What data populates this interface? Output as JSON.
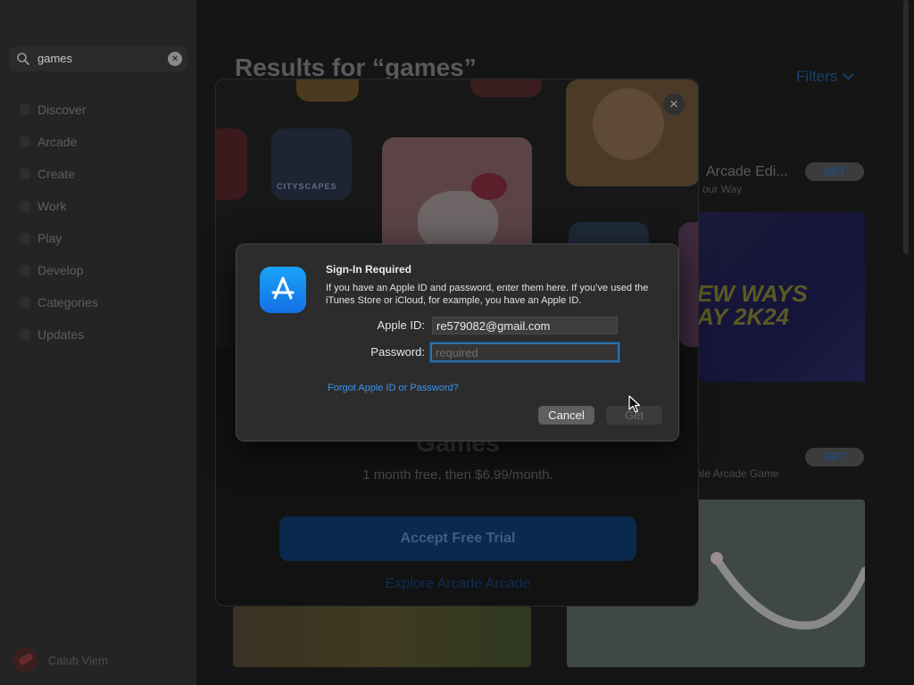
{
  "sidebar": {
    "search_query": "games",
    "items": [
      {
        "label": "Discover"
      },
      {
        "label": "Arcade"
      },
      {
        "label": "Create"
      },
      {
        "label": "Work"
      },
      {
        "label": "Play"
      },
      {
        "label": "Develop"
      },
      {
        "label": "Categories"
      },
      {
        "label": "Updates"
      }
    ],
    "user_name": "Calub Viem"
  },
  "main": {
    "title": "Results for “games”",
    "filters_label": "Filters",
    "result1": {
      "name": "Arcade Edi...",
      "subtitle": "our Way",
      "get_label": "GET"
    },
    "banner_text": "EW WAYS\nAY 2K24",
    "result2": {
      "subtitle": "yale Arcade Game",
      "get_label": "GET"
    }
  },
  "sheet": {
    "tile_label": "CITYSCAPES",
    "heading": "Games",
    "price_text": "1 month free, then $6.99/month.",
    "accept_label": "Accept Free Trial",
    "explore_label": "Explore Arcade Arcade"
  },
  "dialog": {
    "title": "Sign-In Required",
    "body": "If you have an Apple ID and password, enter them here. If you’ve used the iTunes Store or iCloud, for example, you have an Apple ID.",
    "apple_id_label": "Apple ID:",
    "apple_id_value": "re579082@gmail.com",
    "password_label": "Password:",
    "password_placeholder": "required",
    "forgot_link": "Forgot Apple ID or Password?",
    "cancel_label": "Cancel",
    "get_label": "Get"
  },
  "colors": {
    "accent": "#3a93ee",
    "dialog_bg": "#2c2c2c",
    "app_icon_top": "#19a3f7",
    "app_icon_bottom": "#1470e6"
  },
  "icons": [
    "magnifier-icon",
    "clear-icon",
    "chevron-down-icon",
    "close-icon",
    "app-store-icon",
    "pointer-cursor-icon"
  ]
}
